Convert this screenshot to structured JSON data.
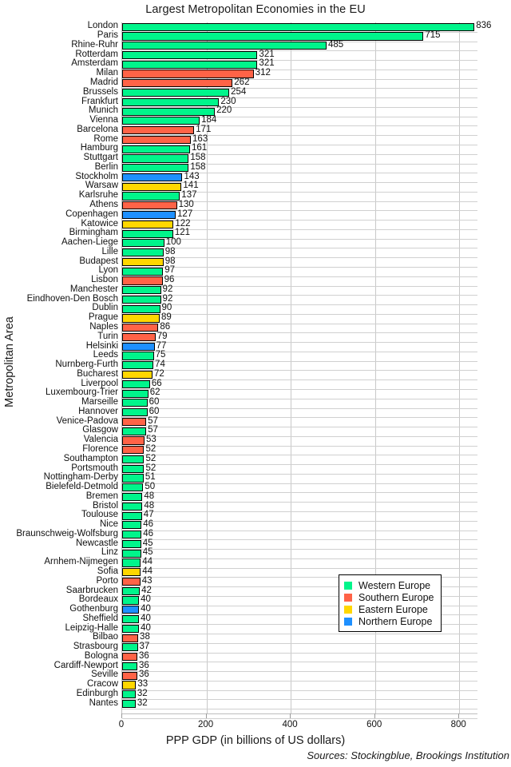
{
  "chart_data": {
    "type": "bar",
    "orientation": "horizontal",
    "title": "Largest Metropolitan Economies in the EU",
    "xlabel": "PPP GDP (in billions of US dollars)",
    "ylabel": "Metropolitan Area",
    "xlim": [
      0,
      845
    ],
    "xticks": [
      0,
      200,
      400,
      600,
      800
    ],
    "xtick_labels": [
      "0",
      "200",
      "400",
      "600",
      "800"
    ],
    "grid": true,
    "grid_axis": "both",
    "legend_position": "lower right",
    "value_labels": true,
    "sources": "Sources: Stockingblue, Brookings Institution",
    "categories": [
      "London",
      "Paris",
      "Rhine-Ruhr",
      "Rotterdam",
      "Amsterdam",
      "Milan",
      "Madrid",
      "Brussels",
      "Frankfurt",
      "Munich",
      "Vienna",
      "Barcelona",
      "Rome",
      "Hamburg",
      "Stuttgart",
      "Berlin",
      "Stockholm",
      "Warsaw",
      "Karlsruhe",
      "Athens",
      "Copenhagen",
      "Katowice",
      "Birmingham",
      "Aachen-Liege",
      "Lille",
      "Budapest",
      "Lyon",
      "Lisbon",
      "Manchester",
      "Eindhoven-Den Bosch",
      "Dublin",
      "Prague",
      "Naples",
      "Turin",
      "Helsinki",
      "Leeds",
      "Nurnberg-Furth",
      "Bucharest",
      "Liverpool",
      "Luxembourg-Trier",
      "Marseille",
      "Hannover",
      "Venice-Padova",
      "Glasgow",
      "Valencia",
      "Florence",
      "Southampton",
      "Portsmouth",
      "Nottingham-Derby",
      "Bielefeld-Detmold",
      "Bremen",
      "Bristol",
      "Toulouse",
      "Nice",
      "Braunschweig-Wolfsburg",
      "Newcastle",
      "Linz",
      "Arnhem-Nijmegen",
      "Sofia",
      "Porto",
      "Saarbrucken",
      "Bordeaux",
      "Gothenburg",
      "Sheffield",
      "Leipzig-Halle",
      "Bilbao",
      "Strasbourg",
      "Bologna",
      "Cardiff-Newport",
      "Seville",
      "Cracow",
      "Edinburgh",
      "Nantes"
    ],
    "values": [
      836,
      715,
      485,
      321,
      321,
      312,
      262,
      254,
      230,
      220,
      184,
      171,
      163,
      161,
      158,
      158,
      143,
      141,
      137,
      130,
      127,
      122,
      121,
      100,
      98,
      98,
      97,
      96,
      92,
      92,
      90,
      89,
      86,
      79,
      77,
      75,
      74,
      72,
      66,
      62,
      60,
      60,
      57,
      57,
      53,
      52,
      52,
      52,
      51,
      50,
      48,
      48,
      47,
      46,
      46,
      45,
      45,
      44,
      44,
      43,
      42,
      40,
      40,
      40,
      40,
      38,
      37,
      36,
      36,
      36,
      33,
      32,
      32
    ],
    "groups": [
      "Western",
      "Western",
      "Western",
      "Western",
      "Western",
      "Southern",
      "Southern",
      "Western",
      "Western",
      "Western",
      "Western",
      "Southern",
      "Southern",
      "Western",
      "Western",
      "Western",
      "Northern",
      "Eastern",
      "Western",
      "Southern",
      "Northern",
      "Eastern",
      "Western",
      "Western",
      "Western",
      "Eastern",
      "Western",
      "Southern",
      "Western",
      "Western",
      "Western",
      "Eastern",
      "Southern",
      "Southern",
      "Northern",
      "Western",
      "Western",
      "Eastern",
      "Western",
      "Western",
      "Western",
      "Western",
      "Southern",
      "Western",
      "Southern",
      "Southern",
      "Western",
      "Western",
      "Western",
      "Western",
      "Western",
      "Western",
      "Western",
      "Western",
      "Western",
      "Western",
      "Western",
      "Western",
      "Eastern",
      "Southern",
      "Western",
      "Western",
      "Northern",
      "Western",
      "Western",
      "Southern",
      "Western",
      "Southern",
      "Western",
      "Southern",
      "Eastern",
      "Western",
      "Western"
    ],
    "legend": [
      {
        "label": "Western Europe",
        "key": "Western",
        "color": "#00f58b"
      },
      {
        "label": "Southern Europe",
        "key": "Southern",
        "color": "#ff6347"
      },
      {
        "label": "Eastern Europe",
        "key": "Eastern",
        "color": "#ffd700"
      },
      {
        "label": "Northern Europe",
        "key": "Northern",
        "color": "#1e90ff"
      }
    ]
  }
}
